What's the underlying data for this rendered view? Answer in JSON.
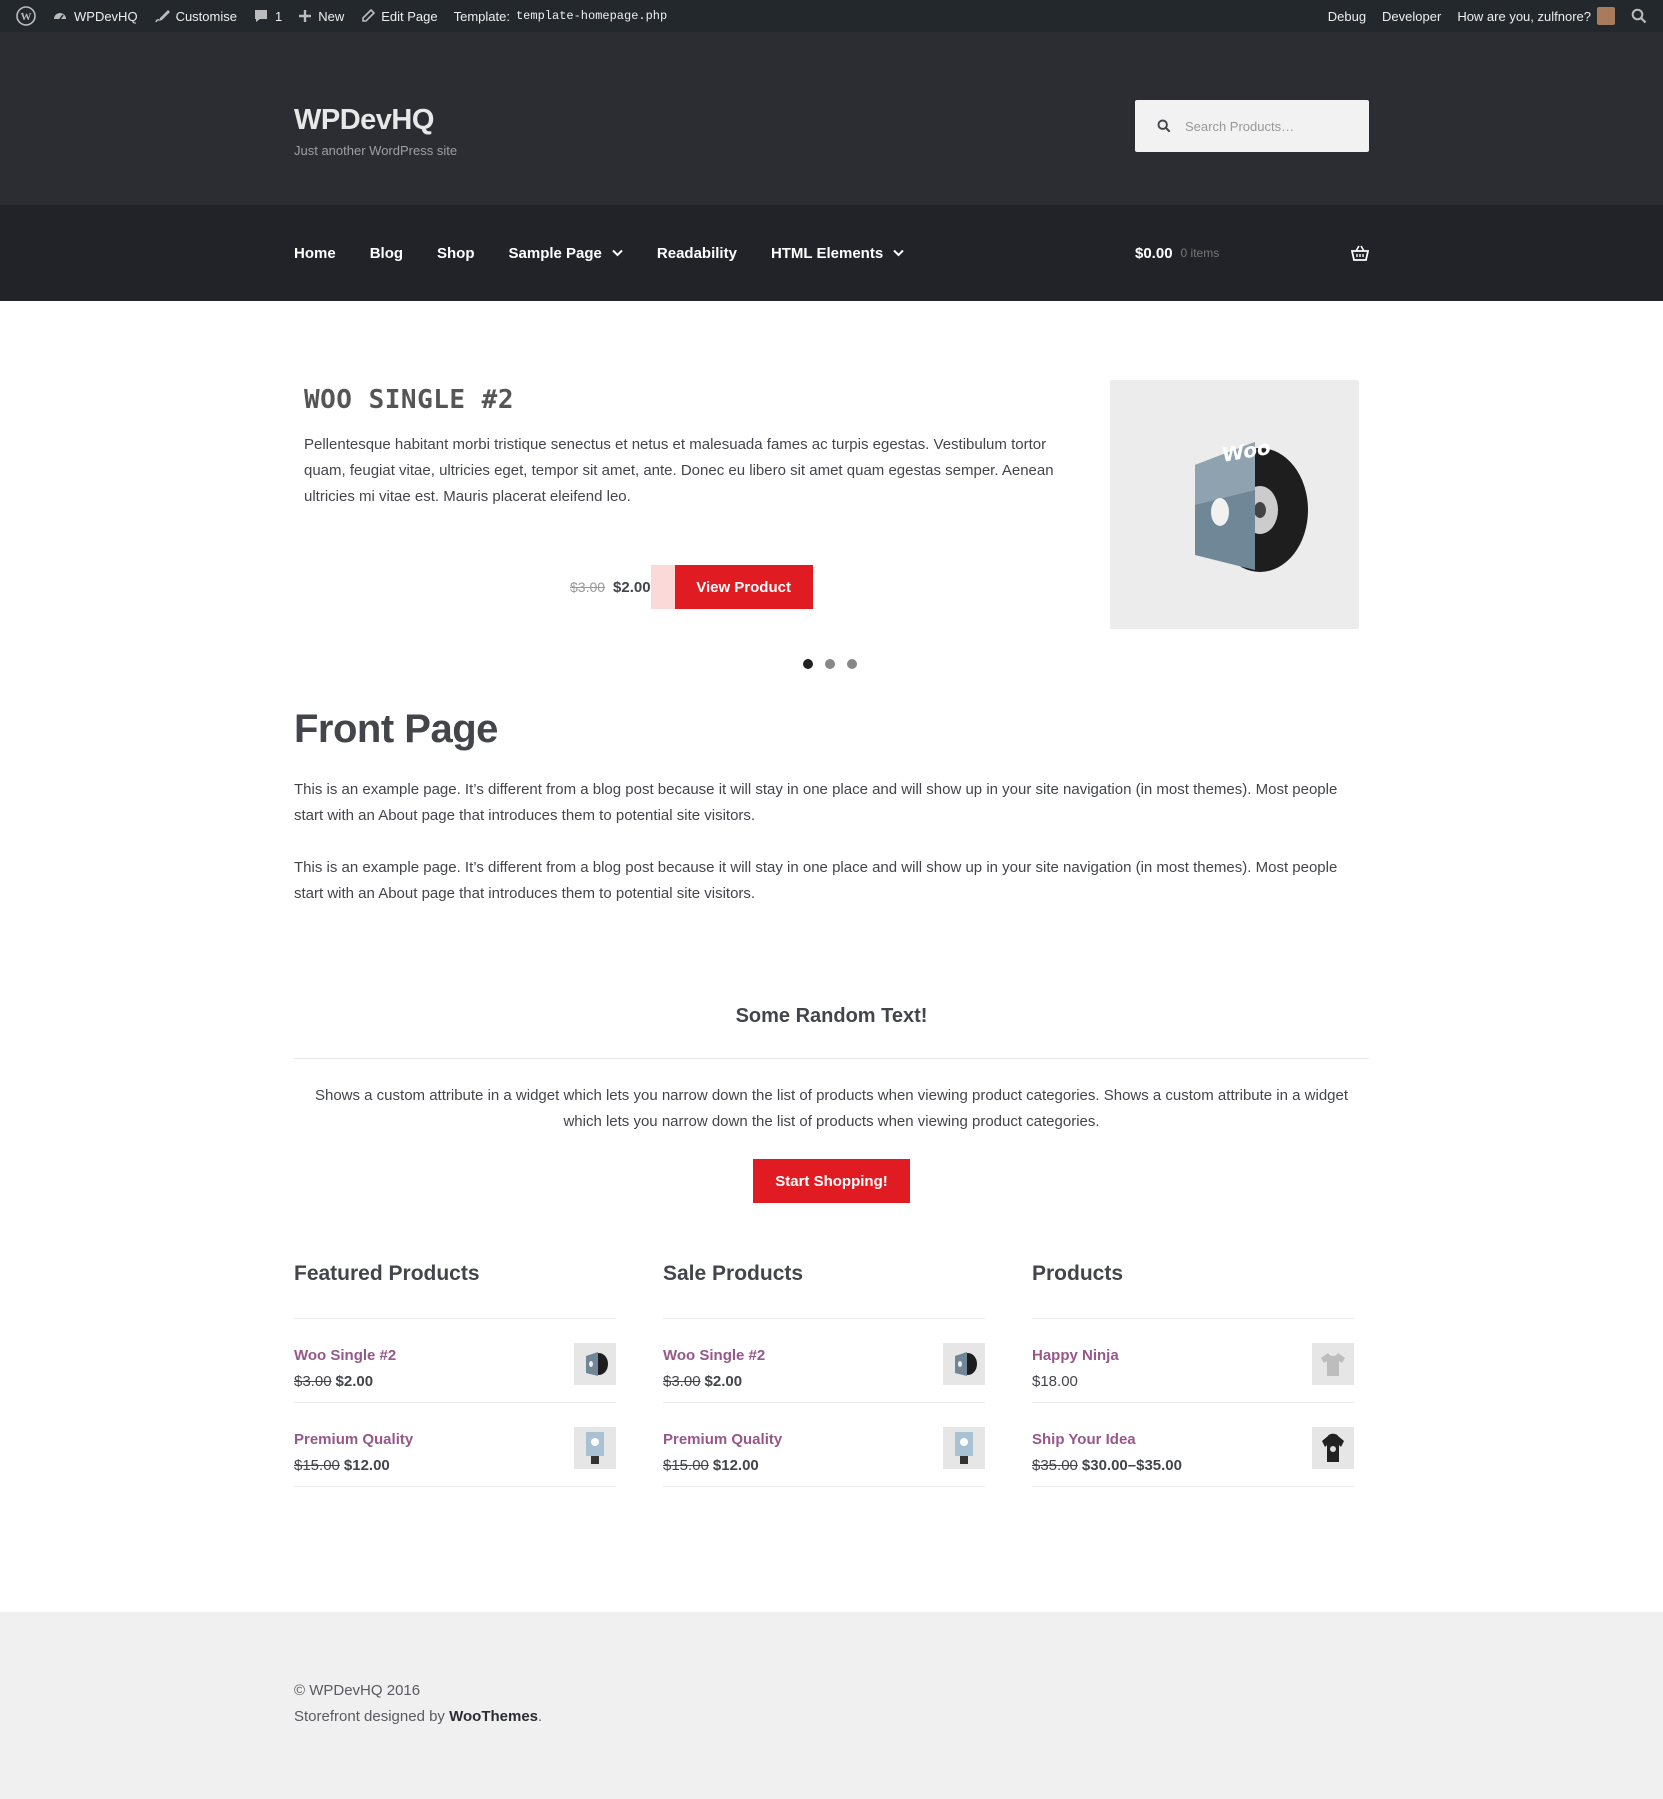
{
  "admin_bar": {
    "site": "WPDevHQ",
    "customise": "Customise",
    "comments": "1",
    "new": "New",
    "edit_page": "Edit Page",
    "template_label": "Template:",
    "template_file": "template-homepage.php",
    "debug": "Debug",
    "developer": "Developer",
    "greeting": "How are you, zulfnore?"
  },
  "header": {
    "site_title": "WPDevHQ",
    "tagline": "Just another WordPress site",
    "search_placeholder": "Search Products…"
  },
  "nav": {
    "items": [
      {
        "label": "Home",
        "has_dropdown": false
      },
      {
        "label": "Blog",
        "has_dropdown": false
      },
      {
        "label": "Shop",
        "has_dropdown": false
      },
      {
        "label": "Sample Page",
        "has_dropdown": true
      },
      {
        "label": "Readability",
        "has_dropdown": false
      },
      {
        "label": "HTML Elements",
        "has_dropdown": true
      }
    ],
    "cart_amount": "$0.00",
    "cart_count": "0 items"
  },
  "slider": {
    "title": "WOO SINGLE #2",
    "description": "Pellentesque habitant morbi tristique senectus et netus et malesuada fames ac turpis egestas. Vestibulum tortor quam, feugiat vitae, ultricies eget, tempor sit amet, ante. Donec eu libero sit amet quam egestas semper. Aenean ultricies mi vitae est. Mauris placerat eleifend leo.",
    "old_price": "$3.00",
    "price": "$2.00",
    "button": "View Product",
    "image_text": "Woo",
    "active_dot": 0
  },
  "page": {
    "title": "Front Page",
    "paragraphs": [
      "This is an example page. It’s different from a blog post because it will stay in one place and will show up in your site navigation (in most themes). Most people start with an About page that introduces them to potential site visitors.",
      "This is an example page. It’s different from a blog post because it will stay in one place and will show up in your site navigation (in most themes). Most people start with an About page that introduces them to potential site visitors."
    ]
  },
  "random_text": {
    "title": "Some Random Text!",
    "body": "Shows a custom attribute in a widget which lets you narrow down the list of products when viewing product categories. Shows a custom attribute in a widget which lets you narrow down the list of products when viewing product categories.",
    "button": "Start Shopping!"
  },
  "product_columns": [
    {
      "title": "Featured Products",
      "products": [
        {
          "name": "Woo Single #2",
          "old": "$3.00",
          "price": "$2.00",
          "icon": "album-icon"
        },
        {
          "name": "Premium Quality",
          "old": "$15.00",
          "price": "$12.00",
          "icon": "poster-icon"
        }
      ]
    },
    {
      "title": "Sale Products",
      "products": [
        {
          "name": "Woo Single #2",
          "old": "$3.00",
          "price": "$2.00",
          "icon": "album-icon"
        },
        {
          "name": "Premium Quality",
          "old": "$15.00",
          "price": "$12.00",
          "icon": "poster-icon"
        }
      ]
    },
    {
      "title": "Products",
      "products": [
        {
          "name": "Happy Ninja",
          "old": "",
          "price": "$18.00",
          "icon": "tshirt-icon"
        },
        {
          "name": "Ship Your Idea",
          "old": "$35.00",
          "price": "$30.00–$35.00",
          "icon": "hoodie-icon"
        }
      ]
    }
  ],
  "footer": {
    "copyright": "© WPDevHQ 2016",
    "designed_by": "Storefront designed by",
    "designer": "WooThemes",
    "period": "."
  },
  "colors": {
    "accent": "#e01b22",
    "link": "#96588a",
    "header_bg": "#2c2d33",
    "nav_bg": "#222328",
    "admin_bg": "#23282d"
  }
}
